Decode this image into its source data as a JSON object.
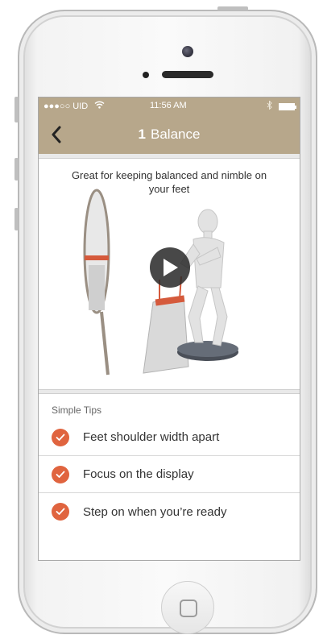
{
  "status_bar": {
    "carrier": "●●●○○ UID",
    "wifi_icon": "wifi-icon",
    "time": "11:56 AM",
    "bluetooth_icon": "bluetooth-icon",
    "battery_icon": "battery-icon"
  },
  "nav": {
    "back_icon": "chevron-left-icon",
    "step_number": "1",
    "title": "Balance"
  },
  "hero": {
    "caption": "Great for keeping balanced and nimble on your feet",
    "play_icon": "play-icon"
  },
  "tips": {
    "header": "Simple Tips",
    "items": [
      {
        "label": "Feet shoulder width apart",
        "checked": true
      },
      {
        "label": "Focus on the display",
        "checked": true
      },
      {
        "label": "Step on when you’re ready",
        "checked": true
      }
    ]
  },
  "colors": {
    "header_bg": "#b7a78b",
    "accent": "#e0643f"
  }
}
